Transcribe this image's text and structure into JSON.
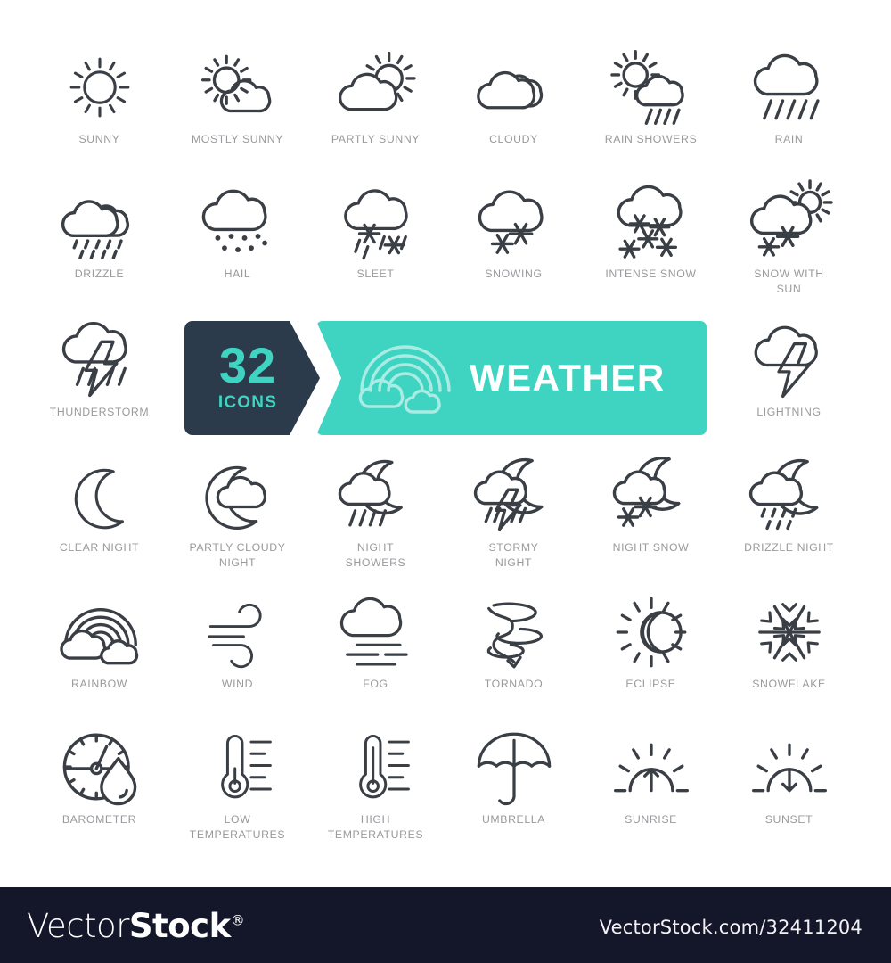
{
  "sheet": {
    "background": "#ffffff",
    "icon_stroke": "#3a3e45",
    "label_color": "#9a9a9e"
  },
  "banner": {
    "count": "32",
    "count_sub": "ICONS",
    "title": "WEATHER",
    "dark_color": "#2b3b4c",
    "teal_color": "#3fd4c2",
    "accent_text_color": "#3fd4c2",
    "title_color": "#ffffff",
    "decor_icon": "rainbow-with-clouds-icon"
  },
  "icons": [
    {
      "label": "SUNNY",
      "icon": "sunny-icon",
      "row": 1,
      "col": 1
    },
    {
      "label": "MOSTLY SUNNY",
      "icon": "mostly-sunny-icon",
      "row": 1,
      "col": 2
    },
    {
      "label": "PARTLY SUNNY",
      "icon": "partly-sunny-icon",
      "row": 1,
      "col": 3
    },
    {
      "label": "CLOUDY",
      "icon": "cloudy-icon",
      "row": 1,
      "col": 4
    },
    {
      "label": "RAIN SHOWERS",
      "icon": "rain-showers-icon",
      "row": 1,
      "col": 5
    },
    {
      "label": "RAIN",
      "icon": "rain-icon",
      "row": 1,
      "col": 6
    },
    {
      "label": "DRIZZLE",
      "icon": "drizzle-icon",
      "row": 2,
      "col": 1
    },
    {
      "label": "HAIL",
      "icon": "hail-icon",
      "row": 2,
      "col": 2
    },
    {
      "label": "SLEET",
      "icon": "sleet-icon",
      "row": 2,
      "col": 3
    },
    {
      "label": "SNOWING",
      "icon": "snowing-icon",
      "row": 2,
      "col": 4
    },
    {
      "label": "INTENSE SNOW",
      "icon": "intense-snow-icon",
      "row": 2,
      "col": 5
    },
    {
      "label": "SNOW WITH\nSUN",
      "icon": "snow-with-sun-icon",
      "row": 2,
      "col": 6
    },
    {
      "label": "THUNDERSTORM",
      "icon": "thunderstorm-icon",
      "row": 3,
      "col": 1
    },
    {
      "label": "LIGHTNING",
      "icon": "lightning-icon",
      "row": 3,
      "col": 6
    },
    {
      "label": "CLEAR NIGHT",
      "icon": "clear-night-icon",
      "row": 4,
      "col": 1
    },
    {
      "label": "PARTLY CLOUDY\nNIGHT",
      "icon": "partly-cloudy-night-icon",
      "row": 4,
      "col": 2
    },
    {
      "label": "NIGHT\nSHOWERS",
      "icon": "night-showers-icon",
      "row": 4,
      "col": 3
    },
    {
      "label": "STORMY\nNIGHT",
      "icon": "stormy-night-icon",
      "row": 4,
      "col": 4
    },
    {
      "label": "NIGHT SNOW",
      "icon": "night-snow-icon",
      "row": 4,
      "col": 5
    },
    {
      "label": "DRIZZLE NIGHT",
      "icon": "drizzle-night-icon",
      "row": 4,
      "col": 6
    },
    {
      "label": "RAINBOW",
      "icon": "rainbow-icon",
      "row": 5,
      "col": 1
    },
    {
      "label": "WIND",
      "icon": "wind-icon",
      "row": 5,
      "col": 2
    },
    {
      "label": "FOG",
      "icon": "fog-icon",
      "row": 5,
      "col": 3
    },
    {
      "label": "TORNADO",
      "icon": "tornado-icon",
      "row": 5,
      "col": 4
    },
    {
      "label": "ECLIPSE",
      "icon": "eclipse-icon",
      "row": 5,
      "col": 5
    },
    {
      "label": "SNOWFLAKE",
      "icon": "snowflake-icon",
      "row": 5,
      "col": 6
    },
    {
      "label": "BAROMETER",
      "icon": "barometer-icon",
      "row": 6,
      "col": 1
    },
    {
      "label": "LOW\nTEMPERATURES",
      "icon": "low-temperature-icon",
      "row": 6,
      "col": 2
    },
    {
      "label": "HIGH\nTEMPERATURES",
      "icon": "high-temperature-icon",
      "row": 6,
      "col": 3
    },
    {
      "label": "UMBRELLA",
      "icon": "umbrella-icon",
      "row": 6,
      "col": 4
    },
    {
      "label": "SUNRISE",
      "icon": "sunrise-icon",
      "row": 6,
      "col": 5
    },
    {
      "label": "SUNSET",
      "icon": "sunset-icon",
      "row": 6,
      "col": 6
    }
  ],
  "footer": {
    "logo_light": "Vector",
    "logo_bold": "Stock",
    "registered_mark": "®",
    "url": "VectorStock.com/32411204",
    "background": "#14162a"
  }
}
